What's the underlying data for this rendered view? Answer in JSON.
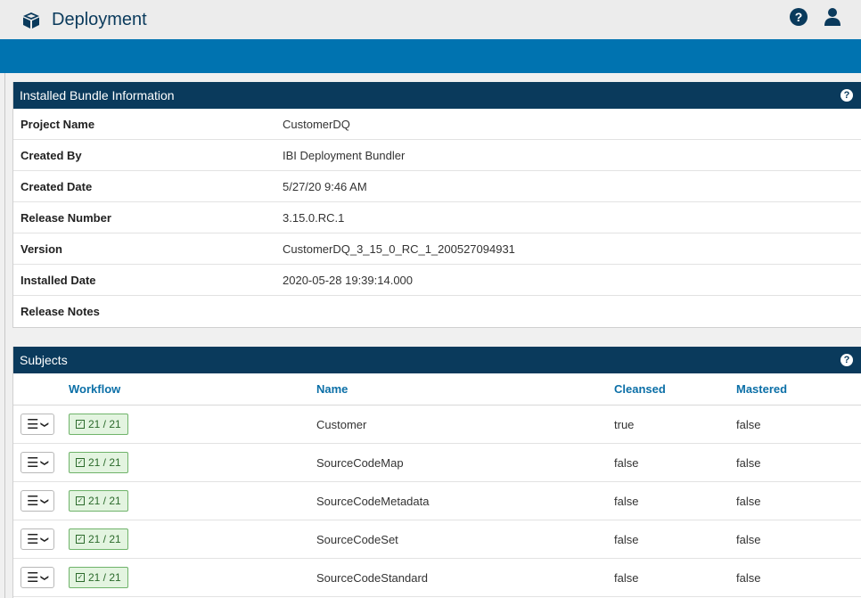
{
  "header": {
    "title": "Deployment"
  },
  "bundle": {
    "title": "Installed Bundle Information",
    "rows": [
      {
        "label": "Project Name",
        "value": "CustomerDQ"
      },
      {
        "label": "Created By",
        "value": "IBI Deployment Bundler"
      },
      {
        "label": "Created Date",
        "value": "5/27/20 9:46 AM"
      },
      {
        "label": "Release Number",
        "value": "3.15.0.RC.1"
      },
      {
        "label": "Version",
        "value": "CustomerDQ_3_15_0_RC_1_200527094931"
      },
      {
        "label": "Installed Date",
        "value": "2020-05-28 19:39:14.000"
      },
      {
        "label": "Release Notes",
        "value": ""
      }
    ]
  },
  "subjects": {
    "title": "Subjects",
    "columns": {
      "workflow": "Workflow",
      "name": "Name",
      "cleansed": "Cleansed",
      "mastered": "Mastered"
    },
    "rows": [
      {
        "workflow": "21 / 21",
        "name": "Customer",
        "cleansed": "true",
        "mastered": "false"
      },
      {
        "workflow": "21 / 21",
        "name": "SourceCodeMap",
        "cleansed": "false",
        "mastered": "false"
      },
      {
        "workflow": "21 / 21",
        "name": "SourceCodeMetadata",
        "cleansed": "false",
        "mastered": "false"
      },
      {
        "workflow": "21 / 21",
        "name": "SourceCodeSet",
        "cleansed": "false",
        "mastered": "false"
      },
      {
        "workflow": "21 / 21",
        "name": "SourceCodeStandard",
        "cleansed": "false",
        "mastered": "false"
      }
    ]
  },
  "icons": {
    "app": "package-box-icon",
    "help": "help-icon",
    "user": "user-icon",
    "row_menu": "hamburger-menu-icon",
    "dropdown": "chevron-down-icon",
    "workflow_status": "checkbox-checked-icon"
  },
  "colors": {
    "header_dark": "#0a3a5c",
    "accent_blue": "#0073b0",
    "column_header": "#0b6fa7",
    "badge_bg": "#e3f4e0",
    "badge_border": "#6fb36a"
  }
}
